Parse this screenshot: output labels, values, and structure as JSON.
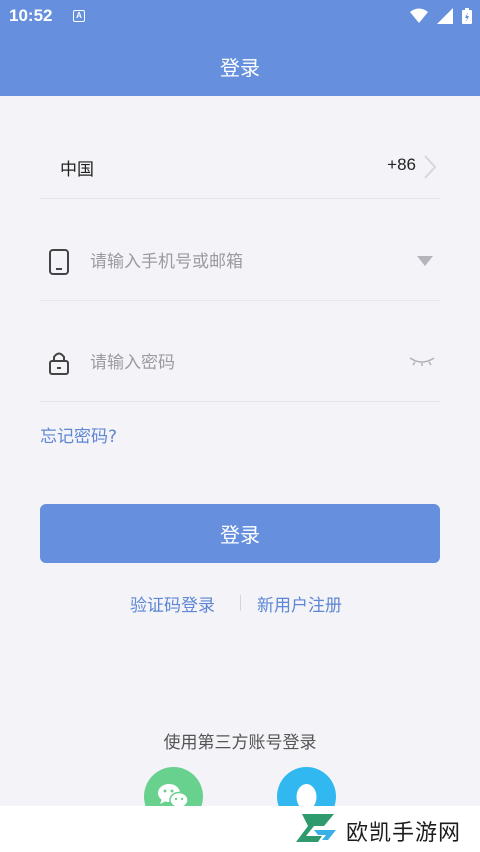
{
  "status_bar": {
    "time": "10:52",
    "notification_glyph": "A",
    "icons": [
      "wifi-icon",
      "signal-icon",
      "battery-charging-icon"
    ]
  },
  "header": {
    "title": "登录"
  },
  "country": {
    "label": "中国",
    "code": "+86"
  },
  "phone_field": {
    "placeholder": "请输入手机号或邮箱",
    "value": ""
  },
  "password_field": {
    "placeholder": "请输入密码",
    "value": ""
  },
  "forgot_password": "忘记密码?",
  "login_button": "登录",
  "alt_links": {
    "sms_login": "验证码登录",
    "register": "新用户注册"
  },
  "third_party": {
    "title": "使用第三方账号登录",
    "providers": [
      "wechat-icon",
      "qq-icon"
    ]
  },
  "watermark": {
    "text": "欧凯手游网"
  },
  "colors": {
    "primary": "#6690de",
    "link": "#5d86d4",
    "background": "#f4f4f8",
    "wechat": "#68d18e",
    "qq": "#31b8f1"
  }
}
